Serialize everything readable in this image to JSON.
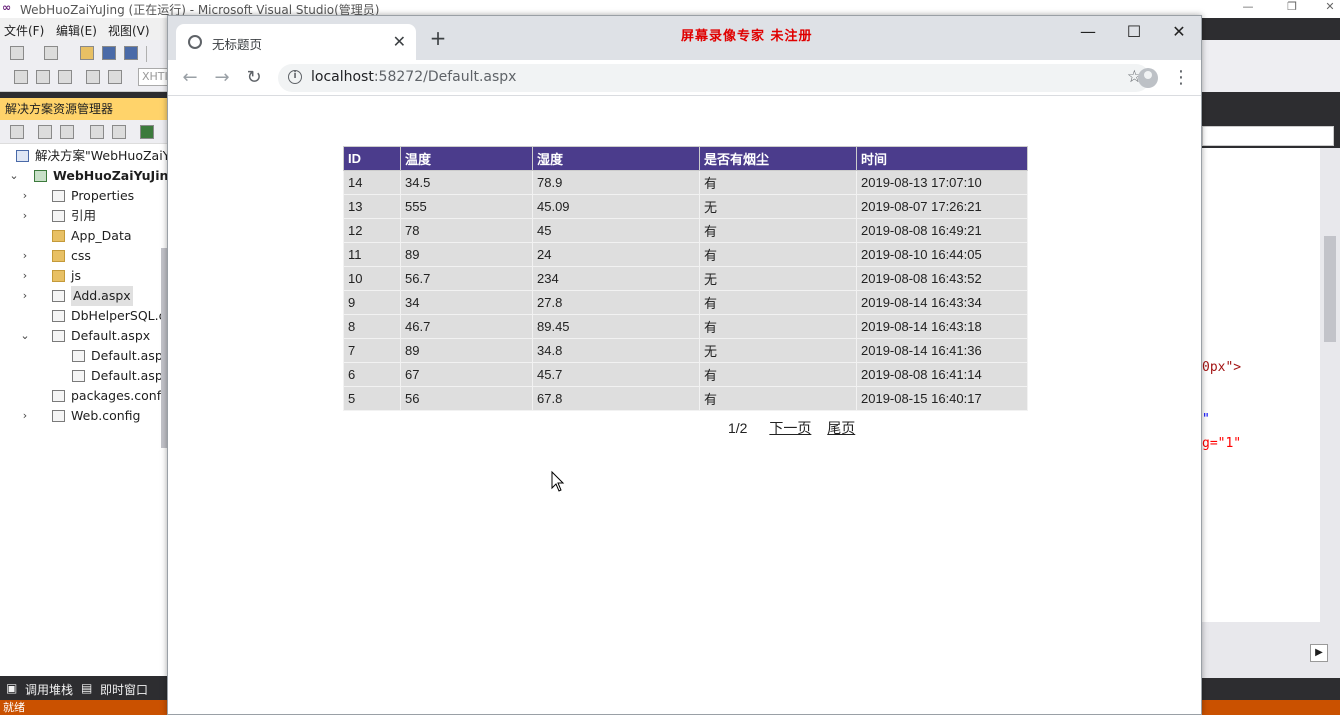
{
  "vs": {
    "window_title": "WebHuoZaiYuJing (正在运行) - Microsoft Visual Studio(管理员)",
    "menu": [
      "文件(F)",
      "编辑(E)",
      "视图(V)"
    ],
    "xhtml_label": "XHTI",
    "solution_explorer": {
      "title": "解决方案资源管理器",
      "items": [
        {
          "label": "解决方案\"WebHuoZaiYu",
          "level": 0,
          "arrow": "",
          "icon": "solution-icon"
        },
        {
          "label": "WebHuoZaiYuJing",
          "level": 0,
          "arrow": "v",
          "icon": "project-icon",
          "bold": true
        },
        {
          "label": "Properties",
          "level": 1,
          "arrow": ">",
          "icon": "properties-icon"
        },
        {
          "label": "引用",
          "level": 1,
          "arrow": ">",
          "icon": "references-icon"
        },
        {
          "label": "App_Data",
          "level": 1,
          "arrow": "",
          "icon": "folder-icon"
        },
        {
          "label": "css",
          "level": 1,
          "arrow": ">",
          "icon": "folder-icon"
        },
        {
          "label": "js",
          "level": 1,
          "arrow": ">",
          "icon": "folder-icon"
        },
        {
          "label": "Add.aspx",
          "level": 1,
          "arrow": ">",
          "icon": "aspx-file-icon"
        },
        {
          "label": "DbHelperSQL.c",
          "level": 1,
          "arrow": "",
          "icon": "cs-file-icon"
        },
        {
          "label": "Default.aspx",
          "level": 1,
          "arrow": "v",
          "icon": "aspx-file-icon"
        },
        {
          "label": "Default.aspx",
          "level": 2,
          "arrow": "",
          "icon": "cs-file-icon"
        },
        {
          "label": "Default.aspx",
          "level": 2,
          "arrow": "",
          "icon": "cs-file-icon"
        },
        {
          "label": "packages.confi",
          "level": 1,
          "arrow": "",
          "icon": "config-file-icon"
        },
        {
          "label": "Web.config",
          "level": 1,
          "arrow": ">",
          "icon": "config-file-icon"
        }
      ]
    },
    "bottom_tabs": [
      "调用堆栈",
      "即时窗口"
    ],
    "status": "就绪",
    "editor_fragments": [
      "0px\">",
      "\"",
      "g=\"1\""
    ]
  },
  "browser": {
    "tab_title": "无标题页",
    "recorder_banner": "屏幕录像专家  未注册",
    "url_host": "localhost",
    "url_rest": ":58272/Default.aspx"
  },
  "grid": {
    "headers": [
      "ID",
      "温度",
      "湿度",
      "是否有烟尘",
      "时间"
    ],
    "rows": [
      [
        "14",
        "34.5",
        "78.9",
        "有",
        "2019-08-13 17:07:10"
      ],
      [
        "13",
        "555",
        "45.09",
        "无",
        "2019-08-07 17:26:21"
      ],
      [
        "12",
        "78",
        "45",
        "有",
        "2019-08-08 16:49:21"
      ],
      [
        "11",
        "89",
        "24",
        "有",
        "2019-08-10 16:44:05"
      ],
      [
        "10",
        "56.7",
        "234",
        "无",
        "2019-08-08 16:43:52"
      ],
      [
        "9",
        "34",
        "27.8",
        "有",
        "2019-08-14 16:43:34"
      ],
      [
        "8",
        "46.7",
        "89.45",
        "有",
        "2019-08-14 16:43:18"
      ],
      [
        "7",
        "89",
        "34.8",
        "无",
        "2019-08-14 16:41:36"
      ],
      [
        "6",
        "67",
        "45.7",
        "有",
        "2019-08-08 16:41:14"
      ],
      [
        "5",
        "56",
        "67.8",
        "有",
        "2019-08-15 16:40:17"
      ]
    ]
  },
  "pager": {
    "page_info": "1/2",
    "next_label": "下一页",
    "last_label": "尾页"
  }
}
